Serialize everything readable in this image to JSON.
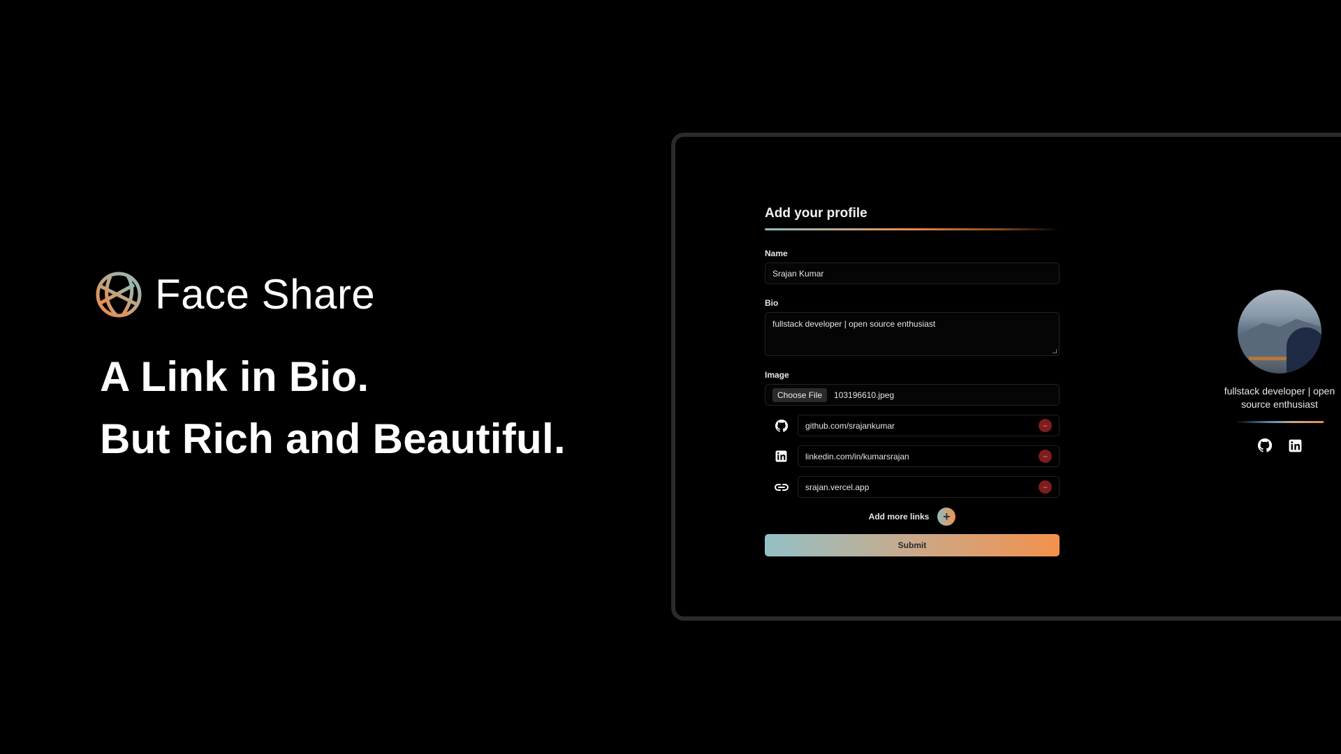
{
  "brand": {
    "name": "Face Share",
    "logo_icon": "globe-icon"
  },
  "tagline": {
    "line1": "A Link in Bio.",
    "line2": "But Rich and Beautiful."
  },
  "colors": {
    "accent_start": "#8fbcc0",
    "accent_end": "#f08a45",
    "remove": "#7f1d1d"
  },
  "form": {
    "title": "Add your profile",
    "name_label": "Name",
    "name_value": "Srajan Kumar",
    "bio_label": "Bio",
    "bio_value": "fullstack developer | open source enthusiast",
    "image_label": "Image",
    "file_button": "Choose File",
    "file_name": "103196610.jpeg",
    "links": [
      {
        "icon": "github-icon",
        "value": "github.com/srajankumar"
      },
      {
        "icon": "linkedin-icon",
        "value": "linkedin.com/in/kumarsrajan"
      },
      {
        "icon": "link-icon",
        "value": "srajan.vercel.app"
      }
    ],
    "remove_symbol": "−",
    "add_more_label": "Add more links",
    "add_symbol": "+",
    "submit_label": "Submit"
  },
  "preview": {
    "bio": "fullstack developer | open source enthusiast",
    "icons": [
      "github-icon",
      "linkedin-icon"
    ]
  }
}
